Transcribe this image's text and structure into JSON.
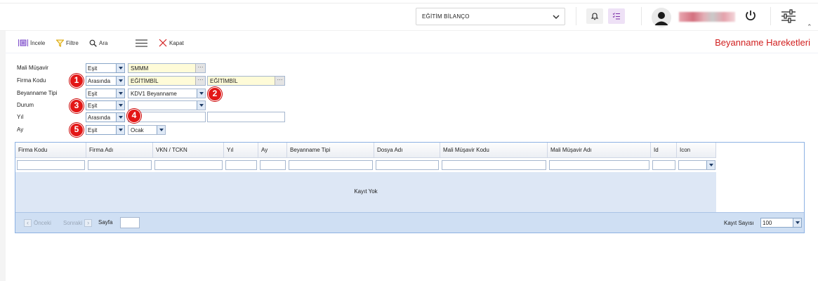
{
  "header": {
    "company_select": "EĞİTİM BİLANÇO",
    "collapse_glyph": "⌃",
    "icons": [
      "chevron-down-icon",
      "bell-icon",
      "task-list-icon",
      "user-avatar-icon",
      "power-icon",
      "settings-sliders-icon"
    ]
  },
  "toolbar": {
    "incele": "İncele",
    "filtre": "Filtre",
    "ara": "Ara",
    "kapat": "Kapat",
    "page_title": "Beyanname Hareketleri"
  },
  "filters": {
    "mali_musavir": {
      "label": "Mali Müşavir",
      "op": "Eşit",
      "value": "SMMM"
    },
    "firma_kodu": {
      "label": "Firma Kodu",
      "op": "Arasında",
      "value_from": "EĞİTİMBİL",
      "value_to": "EĞİTİMBİL"
    },
    "beyanname_tipi": {
      "label": "Beyanname Tipi",
      "op": "Eşit",
      "value": "KDV1 Beyanname"
    },
    "durum": {
      "label": "Durum",
      "op": "Eşit",
      "value": ""
    },
    "yil": {
      "label": "Yıl",
      "op": "Arasında",
      "value_from": "",
      "value_to": ""
    },
    "ay": {
      "label": "Ay",
      "op": "Eşit",
      "value": "Ocak"
    }
  },
  "badges": [
    "1",
    "2",
    "3",
    "4",
    "5"
  ],
  "grid": {
    "columns": [
      "Firma Kodu",
      "Firma Adı",
      "VKN / TCKN",
      "Yıl",
      "Ay",
      "Beyanname Tipi",
      "Dosya Adı",
      "Mali Müşavir Kodu",
      "Mali Müşavir Adı",
      "Id",
      "Icon"
    ],
    "empty_text": "Kayıt Yok"
  },
  "pager": {
    "prev": "Önceki",
    "next": "Sonraki",
    "page_label": "Sayfa",
    "page_value": "",
    "record_count_label": "Kayıt Sayısı",
    "page_size": "100"
  },
  "colors": {
    "title_red": "#d11f1f",
    "badge_red": "#e31717",
    "grid_border": "#8db2e3",
    "grid_body": "#dde7f5"
  }
}
